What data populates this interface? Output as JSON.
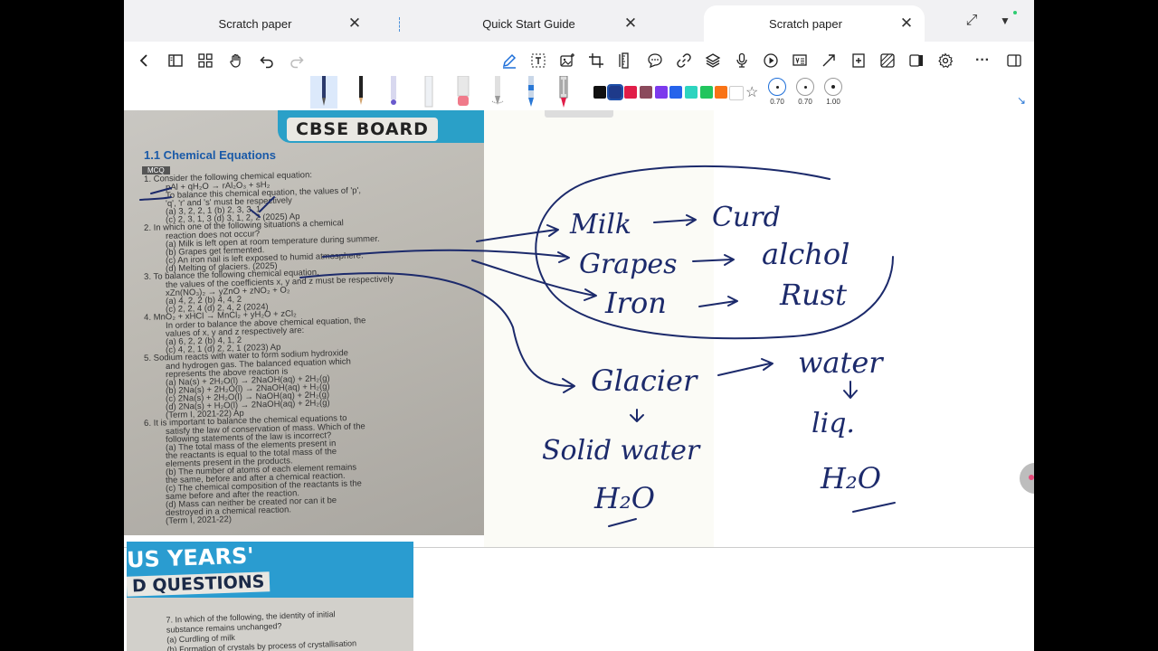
{
  "tabs": [
    {
      "label": "Scratch paper",
      "active": false
    },
    {
      "label": "Quick Start Guide",
      "active": false
    },
    {
      "label": "Scratch paper",
      "active": true
    }
  ],
  "tab_close_glyph": "✕",
  "toolbar_icons": [
    "back-icon",
    "sidebar-icon",
    "grid-icon",
    "hand-icon",
    "undo-icon",
    "redo-icon",
    "pen-icon",
    "text-box-icon",
    "image-icon",
    "crop-icon",
    "ruler-icon",
    "comment-icon",
    "link-icon",
    "layers-icon",
    "microphone-icon",
    "play-icon",
    "ocr-icon",
    "expand-icon",
    "add-page-icon",
    "pattern-icon",
    "split-view-icon",
    "settings-icon",
    "more-icon",
    "panel-icon"
  ],
  "swatches": [
    "#111111",
    "#1e3a8a",
    "#e11d48",
    "#8b4a5c",
    "#7c3aed",
    "#2563eb",
    "#2dd4bf",
    "#22c55e",
    "#f97316",
    "#ffffff"
  ],
  "sizes": [
    "0.70",
    "0.70",
    "1.00"
  ],
  "scan": {
    "banner": "CBSE BOARD",
    "section": "1.1 Chemical Equations",
    "mcq": "MCQ",
    "questions": [
      "1.  Consider the following chemical equation:",
      "pAl + qH₂O → rAl₂O₃ + sH₂",
      "To balance this chemical equation, the values of 'p',",
      "'q', 'r' and 's' must be respectively",
      "(a) 3, 2, 2, 1        (b) 2, 3, 3, 1",
      "(c) 2, 3, 1, 3        (d) 3, 1, 2, 2   (2025) Ap",
      "2.  In which one of the following situations a chemical",
      "reaction does not occur?",
      "(a) Milk is left open at room temperature during summer.",
      "(b) Grapes get fermented.",
      "(c) An iron nail is left exposed to humid atmosphere.",
      "(d) Melting of glaciers.                 (2025)",
      "3.  To balance the following chemical equation,",
      "the values of the coefficients x, y and z must be respectively",
      "xZn(NO₃)₂ → yZnO + zNO₂ + O₂",
      "(a) 4, 2, 2        (b) 4, 4, 2",
      "(c) 2, 2, 4        (d) 2, 4, 2   (2024)",
      "4.  MnO₂ + xHCl → MnCl₂ + yH₂O + zCl₂",
      "In order to balance the above chemical equation, the",
      "values of x, y and z respectively are:",
      "(a) 6, 2, 2        (b) 4, 1, 2",
      "(c) 4, 2, 1        (d) 2, 2, 1   (2023) Ap",
      "5.  Sodium reacts with water to form sodium hydroxide",
      "and hydrogen gas. The balanced equation which",
      "represents the above reaction is",
      "(a) Na(s) + 2H₂O(l) → 2NaOH(aq) + 2H₂(g)",
      "(b) 2Na(s) + 2H₂O(l) → 2NaOH(aq) + H₂(g)",
      "(c) 2Na(s) + 2H₂O(l) → NaOH(aq) + 2H₂(g)",
      "(d) 2Na(s) + H₂O(l) → 2NaOH(aq) + 2H₂(g)",
      "(Term I, 2021-22) Ap",
      "6.  It is important to balance the chemical equations to",
      "satisfy the law of conservation of mass. Which of the",
      "following statements of the law is incorrect?",
      "(a) The total mass of the elements present in",
      "the reactants is equal to the total mass of the",
      "elements present in the products.",
      "(b) The number of atoms of each element remains",
      "the same, before and after a chemical reaction.",
      "(c) The chemical composition of the reactants is the",
      "same before and after the reaction.",
      "(d) Mass can neither be created nor can it be",
      "destroyed in a chemical reaction.",
      "(Term I, 2021-22)"
    ]
  },
  "scan2": {
    "title1": "US YEARS'",
    "title2": "D QUESTIONS",
    "q7": [
      "7.  In which of the following, the identity of initial",
      "substance remains unchanged?",
      "(a) Curdling of milk",
      "(b) Formation of crystals by process of crystallisation"
    ]
  },
  "handwriting": {
    "milk": "Milk",
    "curd": "Curd",
    "grapes": "Grapes",
    "alchol": "alchol",
    "iron": "Iron",
    "rust": "Rust",
    "glacier": "Glacier",
    "water": "water",
    "solid_water": "Solid water",
    "liq": "liq.",
    "h2o_1": "H₂O",
    "h2o_2": "H₂O"
  }
}
